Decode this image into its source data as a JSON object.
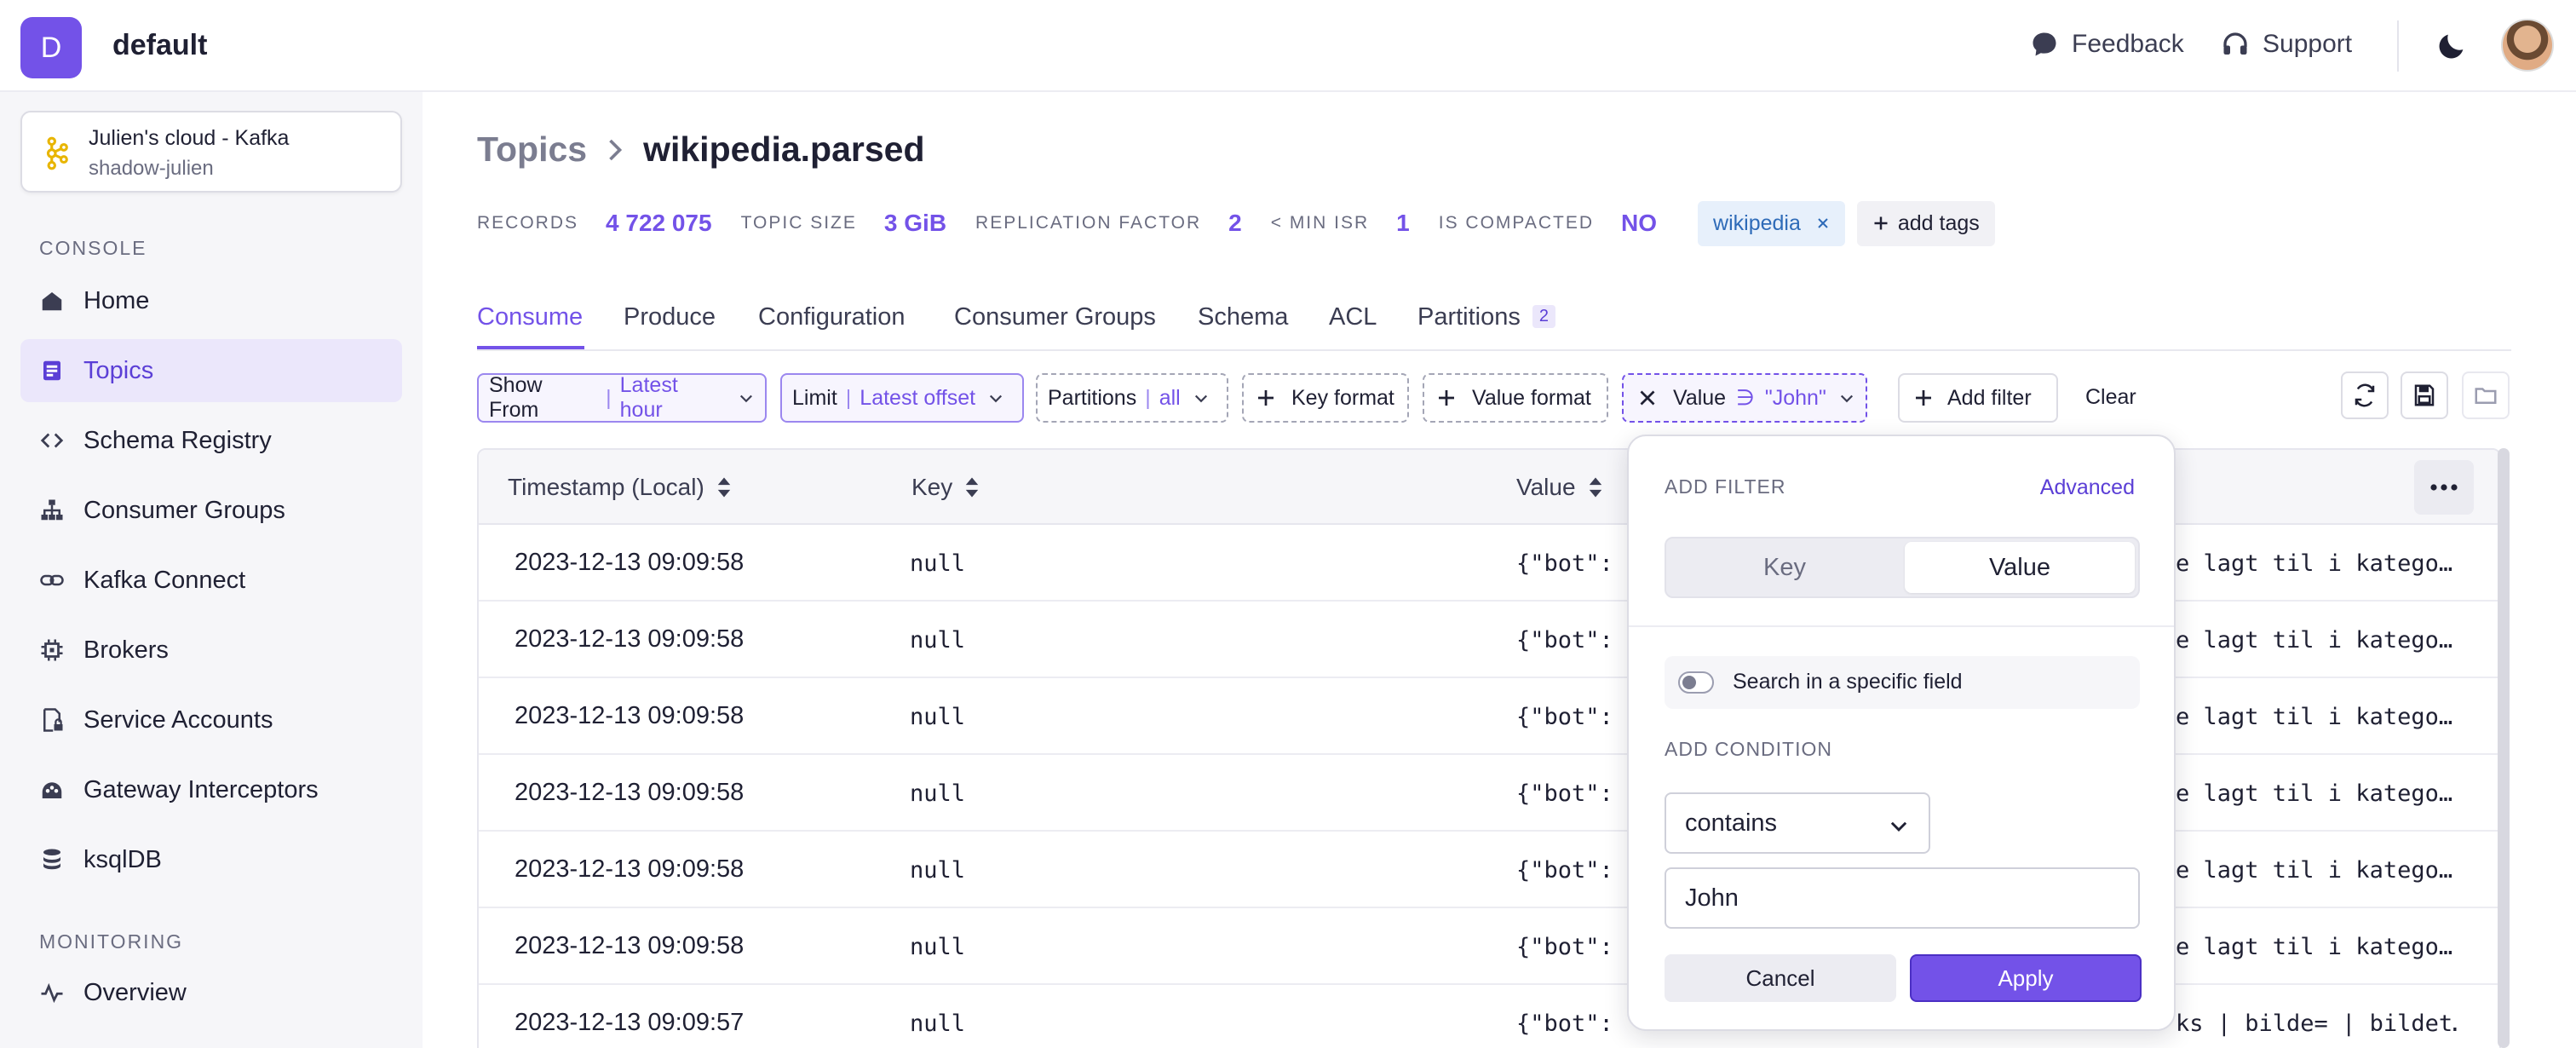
{
  "header": {
    "org_initial": "D",
    "org_name": "default",
    "feedback_label": "Feedback",
    "support_label": "Support"
  },
  "sidebar": {
    "cluster": {
      "title": "Julien's cloud - Kafka",
      "subtitle": "shadow-julien"
    },
    "sections": [
      {
        "title": "CONSOLE",
        "items": [
          {
            "label": "Home",
            "icon": "home-icon"
          },
          {
            "label": "Topics",
            "icon": "topics-icon",
            "active": true
          },
          {
            "label": "Schema Registry",
            "icon": "code-icon"
          },
          {
            "label": "Consumer Groups",
            "icon": "hierarchy-icon"
          },
          {
            "label": "Kafka Connect",
            "icon": "link-icon"
          },
          {
            "label": "Brokers",
            "icon": "chip-icon"
          },
          {
            "label": "Service Accounts",
            "icon": "doc-lock-icon"
          },
          {
            "label": "Gateway Interceptors",
            "icon": "gateway-icon"
          },
          {
            "label": "ksqlDB",
            "icon": "database-icon"
          }
        ]
      },
      {
        "title": "MONITORING",
        "items": [
          {
            "label": "Overview",
            "icon": "pulse-icon"
          }
        ]
      }
    ]
  },
  "breadcrumb": {
    "parent": "Topics",
    "current": "wikipedia.parsed"
  },
  "stats": {
    "records_label": "RECORDS",
    "records_value": "4 722 075",
    "size_label": "TOPIC SIZE",
    "size_value": "3 GiB",
    "replication_label": "REPLICATION FACTOR",
    "replication_value": "2",
    "minisr_label": "< MIN ISR",
    "minisr_value": "1",
    "compacted_label": "IS COMPACTED",
    "compacted_value": "NO",
    "tag": "wikipedia",
    "add_tags": "add tags"
  },
  "tabs": [
    {
      "label": "Consume",
      "active": true
    },
    {
      "label": "Produce"
    },
    {
      "label": "Configuration"
    },
    {
      "label": "Consumer Groups"
    },
    {
      "label": "Schema"
    },
    {
      "label": "ACL"
    },
    {
      "label": "Partitions",
      "badge": "2"
    }
  ],
  "toolbar": {
    "show_from_label": "Show From",
    "show_from_value": "Latest hour",
    "limit_label": "Limit",
    "limit_value": "Latest offset",
    "partitions_label": "Partitions",
    "partitions_value": "all",
    "key_format": "Key format",
    "value_format": "Value format",
    "value_filter_label": "Value",
    "value_filter_op": "∋",
    "value_filter_value": "\"John\"",
    "add_filter": "Add filter",
    "clear": "Clear"
  },
  "table": {
    "columns": [
      "Timestamp (Local)",
      "Key",
      "Value"
    ],
    "rows": [
      {
        "ts": "2023-12-13 09:09:58",
        "key": "null",
        "val_left": "{\"bot\":",
        "val_right": "e lagt til i katego…"
      },
      {
        "ts": "2023-12-13 09:09:58",
        "key": "null",
        "val_left": "{\"bot\":",
        "val_right": "e lagt til i katego…"
      },
      {
        "ts": "2023-12-13 09:09:58",
        "key": "null",
        "val_left": "{\"bot\":",
        "val_right": "e lagt til i katego…"
      },
      {
        "ts": "2023-12-13 09:09:58",
        "key": "null",
        "val_left": "{\"bot\":",
        "val_right": "e lagt til i katego…"
      },
      {
        "ts": "2023-12-13 09:09:58",
        "key": "null",
        "val_left": "{\"bot\":",
        "val_right": "e lagt til i katego…"
      },
      {
        "ts": "2023-12-13 09:09:58",
        "key": "null",
        "val_left": "{\"bot\":",
        "val_right": "e lagt til i katego…"
      },
      {
        "ts": "2023-12-13 09:09:57",
        "key": "null",
        "val_left": "{\"bot\":",
        "val_right": "ks | bilde= | bildet…"
      }
    ]
  },
  "filter_popover": {
    "title": "ADD FILTER",
    "advanced": "Advanced",
    "segment_key": "Key",
    "segment_value": "Value",
    "specific_field": "Search in a specific field",
    "condition_title": "ADD CONDITION",
    "condition_operator": "contains",
    "condition_value": "John",
    "cancel": "Cancel",
    "apply": "Apply"
  },
  "colors": {
    "accent": "#7352e8",
    "tag_bg": "#e7f0fb",
    "tag_text": "#2e6bb8"
  }
}
